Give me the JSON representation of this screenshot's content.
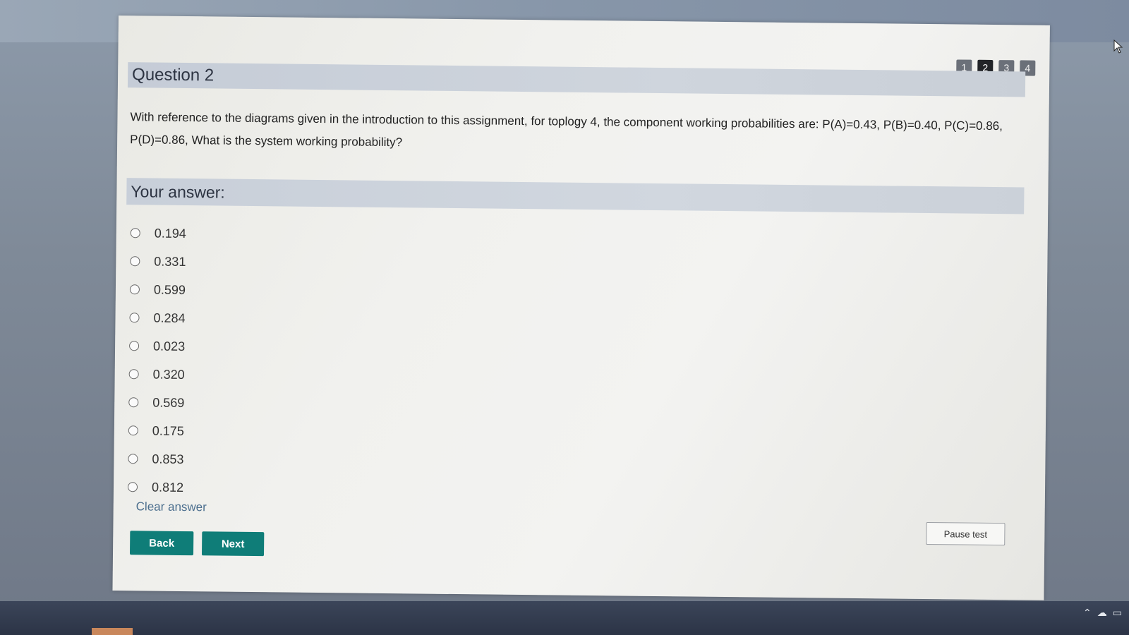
{
  "pager": {
    "pages": [
      "1",
      "2",
      "3",
      "4"
    ],
    "active": "2"
  },
  "question": {
    "title": "Question 2",
    "text": "With reference to the diagrams given in the introduction to this assignment, for toplogy 4, the component working probabilities are: P(A)=0.43, P(B)=0.40, P(C)=0.86, P(D)=0.86, What is the system working probability?"
  },
  "answer": {
    "header": "Your answer:",
    "options": [
      "0.194",
      "0.331",
      "0.599",
      "0.284",
      "0.023",
      "0.320",
      "0.569",
      "0.175",
      "0.853",
      "0.812"
    ],
    "selected": null,
    "clear_label": "Clear answer"
  },
  "nav": {
    "back_label": "Back",
    "next_label": "Next",
    "pause_label": "Pause test"
  },
  "colors": {
    "accent": "#0f7d78",
    "pager_active": "#222428",
    "pager_inactive": "#6b7079",
    "header_band": "#c8cfd9"
  },
  "icons": {
    "cursor": "mouse-pointer-icon",
    "tray": [
      "chevron-up-icon",
      "cloud-icon",
      "battery-icon"
    ]
  }
}
